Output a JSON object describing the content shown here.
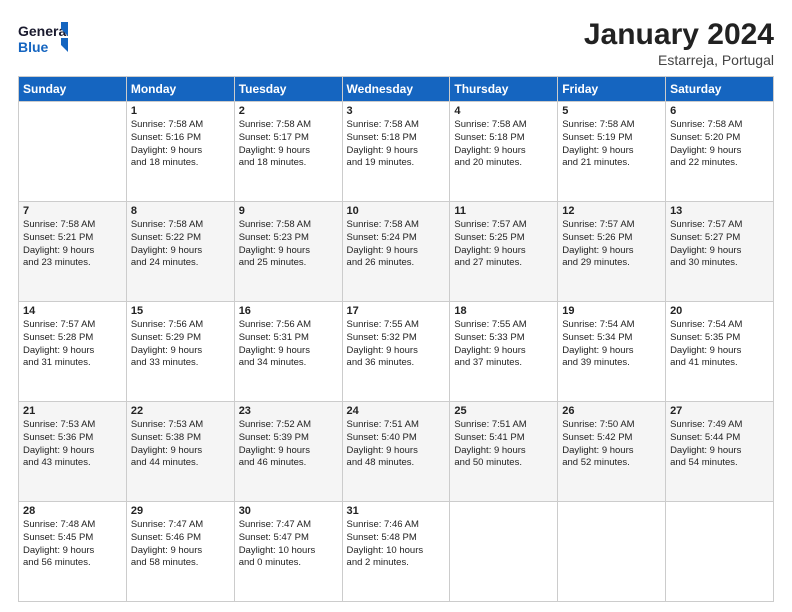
{
  "header": {
    "logo_line1": "General",
    "logo_line2": "Blue",
    "month": "January 2024",
    "location": "Estarreja, Portugal"
  },
  "columns": [
    "Sunday",
    "Monday",
    "Tuesday",
    "Wednesday",
    "Thursday",
    "Friday",
    "Saturday"
  ],
  "weeks": [
    [
      {
        "day": "",
        "sunrise": "",
        "sunset": "",
        "daylight": ""
      },
      {
        "day": "1",
        "sunrise": "Sunrise: 7:58 AM",
        "sunset": "Sunset: 5:16 PM",
        "daylight": "Daylight: 9 hours and 18 minutes."
      },
      {
        "day": "2",
        "sunrise": "Sunrise: 7:58 AM",
        "sunset": "Sunset: 5:17 PM",
        "daylight": "Daylight: 9 hours and 18 minutes."
      },
      {
        "day": "3",
        "sunrise": "Sunrise: 7:58 AM",
        "sunset": "Sunset: 5:18 PM",
        "daylight": "Daylight: 9 hours and 19 minutes."
      },
      {
        "day": "4",
        "sunrise": "Sunrise: 7:58 AM",
        "sunset": "Sunset: 5:18 PM",
        "daylight": "Daylight: 9 hours and 20 minutes."
      },
      {
        "day": "5",
        "sunrise": "Sunrise: 7:58 AM",
        "sunset": "Sunset: 5:19 PM",
        "daylight": "Daylight: 9 hours and 21 minutes."
      },
      {
        "day": "6",
        "sunrise": "Sunrise: 7:58 AM",
        "sunset": "Sunset: 5:20 PM",
        "daylight": "Daylight: 9 hours and 22 minutes."
      }
    ],
    [
      {
        "day": "7",
        "sunrise": "Sunrise: 7:58 AM",
        "sunset": "Sunset: 5:21 PM",
        "daylight": "Daylight: 9 hours and 23 minutes."
      },
      {
        "day": "8",
        "sunrise": "Sunrise: 7:58 AM",
        "sunset": "Sunset: 5:22 PM",
        "daylight": "Daylight: 9 hours and 24 minutes."
      },
      {
        "day": "9",
        "sunrise": "Sunrise: 7:58 AM",
        "sunset": "Sunset: 5:23 PM",
        "daylight": "Daylight: 9 hours and 25 minutes."
      },
      {
        "day": "10",
        "sunrise": "Sunrise: 7:58 AM",
        "sunset": "Sunset: 5:24 PM",
        "daylight": "Daylight: 9 hours and 26 minutes."
      },
      {
        "day": "11",
        "sunrise": "Sunrise: 7:57 AM",
        "sunset": "Sunset: 5:25 PM",
        "daylight": "Daylight: 9 hours and 27 minutes."
      },
      {
        "day": "12",
        "sunrise": "Sunrise: 7:57 AM",
        "sunset": "Sunset: 5:26 PM",
        "daylight": "Daylight: 9 hours and 29 minutes."
      },
      {
        "day": "13",
        "sunrise": "Sunrise: 7:57 AM",
        "sunset": "Sunset: 5:27 PM",
        "daylight": "Daylight: 9 hours and 30 minutes."
      }
    ],
    [
      {
        "day": "14",
        "sunrise": "Sunrise: 7:57 AM",
        "sunset": "Sunset: 5:28 PM",
        "daylight": "Daylight: 9 hours and 31 minutes."
      },
      {
        "day": "15",
        "sunrise": "Sunrise: 7:56 AM",
        "sunset": "Sunset: 5:29 PM",
        "daylight": "Daylight: 9 hours and 33 minutes."
      },
      {
        "day": "16",
        "sunrise": "Sunrise: 7:56 AM",
        "sunset": "Sunset: 5:31 PM",
        "daylight": "Daylight: 9 hours and 34 minutes."
      },
      {
        "day": "17",
        "sunrise": "Sunrise: 7:55 AM",
        "sunset": "Sunset: 5:32 PM",
        "daylight": "Daylight: 9 hours and 36 minutes."
      },
      {
        "day": "18",
        "sunrise": "Sunrise: 7:55 AM",
        "sunset": "Sunset: 5:33 PM",
        "daylight": "Daylight: 9 hours and 37 minutes."
      },
      {
        "day": "19",
        "sunrise": "Sunrise: 7:54 AM",
        "sunset": "Sunset: 5:34 PM",
        "daylight": "Daylight: 9 hours and 39 minutes."
      },
      {
        "day": "20",
        "sunrise": "Sunrise: 7:54 AM",
        "sunset": "Sunset: 5:35 PM",
        "daylight": "Daylight: 9 hours and 41 minutes."
      }
    ],
    [
      {
        "day": "21",
        "sunrise": "Sunrise: 7:53 AM",
        "sunset": "Sunset: 5:36 PM",
        "daylight": "Daylight: 9 hours and 43 minutes."
      },
      {
        "day": "22",
        "sunrise": "Sunrise: 7:53 AM",
        "sunset": "Sunset: 5:38 PM",
        "daylight": "Daylight: 9 hours and 44 minutes."
      },
      {
        "day": "23",
        "sunrise": "Sunrise: 7:52 AM",
        "sunset": "Sunset: 5:39 PM",
        "daylight": "Daylight: 9 hours and 46 minutes."
      },
      {
        "day": "24",
        "sunrise": "Sunrise: 7:51 AM",
        "sunset": "Sunset: 5:40 PM",
        "daylight": "Daylight: 9 hours and 48 minutes."
      },
      {
        "day": "25",
        "sunrise": "Sunrise: 7:51 AM",
        "sunset": "Sunset: 5:41 PM",
        "daylight": "Daylight: 9 hours and 50 minutes."
      },
      {
        "day": "26",
        "sunrise": "Sunrise: 7:50 AM",
        "sunset": "Sunset: 5:42 PM",
        "daylight": "Daylight: 9 hours and 52 minutes."
      },
      {
        "day": "27",
        "sunrise": "Sunrise: 7:49 AM",
        "sunset": "Sunset: 5:44 PM",
        "daylight": "Daylight: 9 hours and 54 minutes."
      }
    ],
    [
      {
        "day": "28",
        "sunrise": "Sunrise: 7:48 AM",
        "sunset": "Sunset: 5:45 PM",
        "daylight": "Daylight: 9 hours and 56 minutes."
      },
      {
        "day": "29",
        "sunrise": "Sunrise: 7:47 AM",
        "sunset": "Sunset: 5:46 PM",
        "daylight": "Daylight: 9 hours and 58 minutes."
      },
      {
        "day": "30",
        "sunrise": "Sunrise: 7:47 AM",
        "sunset": "Sunset: 5:47 PM",
        "daylight": "Daylight: 10 hours and 0 minutes."
      },
      {
        "day": "31",
        "sunrise": "Sunrise: 7:46 AM",
        "sunset": "Sunset: 5:48 PM",
        "daylight": "Daylight: 10 hours and 2 minutes."
      },
      {
        "day": "",
        "sunrise": "",
        "sunset": "",
        "daylight": ""
      },
      {
        "day": "",
        "sunrise": "",
        "sunset": "",
        "daylight": ""
      },
      {
        "day": "",
        "sunrise": "",
        "sunset": "",
        "daylight": ""
      }
    ]
  ]
}
